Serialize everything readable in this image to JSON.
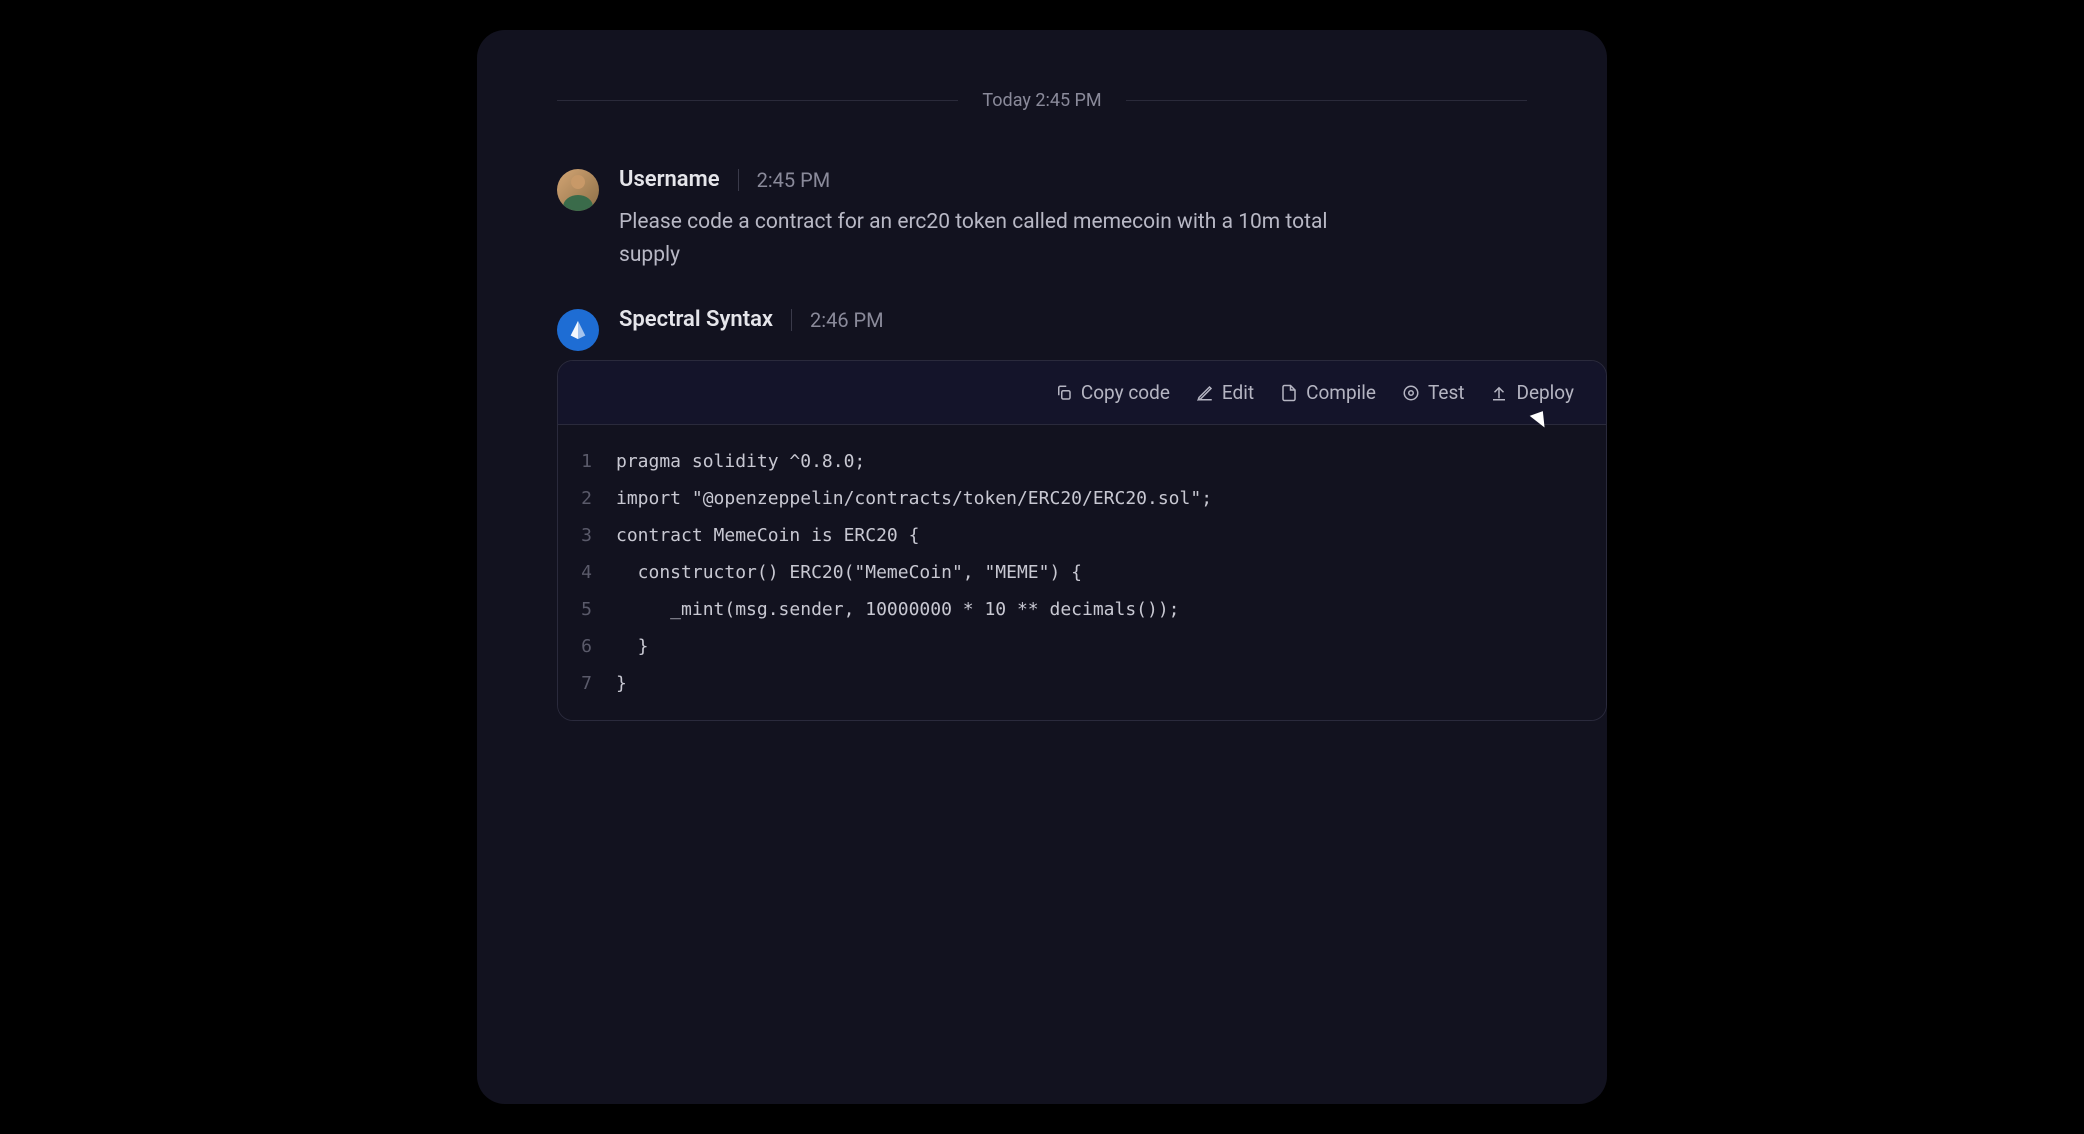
{
  "divider": {
    "text": "Today 2:45 PM"
  },
  "messages": [
    {
      "author": "Username",
      "time": "2:45 PM",
      "text": "Please code a contract for an erc20 token called memecoin with a 10m total supply"
    },
    {
      "author": "Spectral Syntax",
      "time": "2:46 PM"
    }
  ],
  "toolbar": {
    "copy": "Copy code",
    "edit": "Edit",
    "compile": "Compile",
    "test": "Test",
    "deploy": "Deploy"
  },
  "code": {
    "lines": [
      {
        "num": "1",
        "content": "pragma solidity ^0.8.0;"
      },
      {
        "num": "2",
        "content": "import \"@openzeppelin/contracts/token/ERC20/ERC20.sol\";"
      },
      {
        "num": "3",
        "content": "contract MemeCoin is ERC20 {"
      },
      {
        "num": "4",
        "content": "  constructor() ERC20(\"MemeCoin\", \"MEME\") {"
      },
      {
        "num": "5",
        "content": "     _mint(msg.sender, 10000000 * 10 ** decimals());"
      },
      {
        "num": "6",
        "content": "  }"
      },
      {
        "num": "7",
        "content": "}"
      }
    ]
  }
}
